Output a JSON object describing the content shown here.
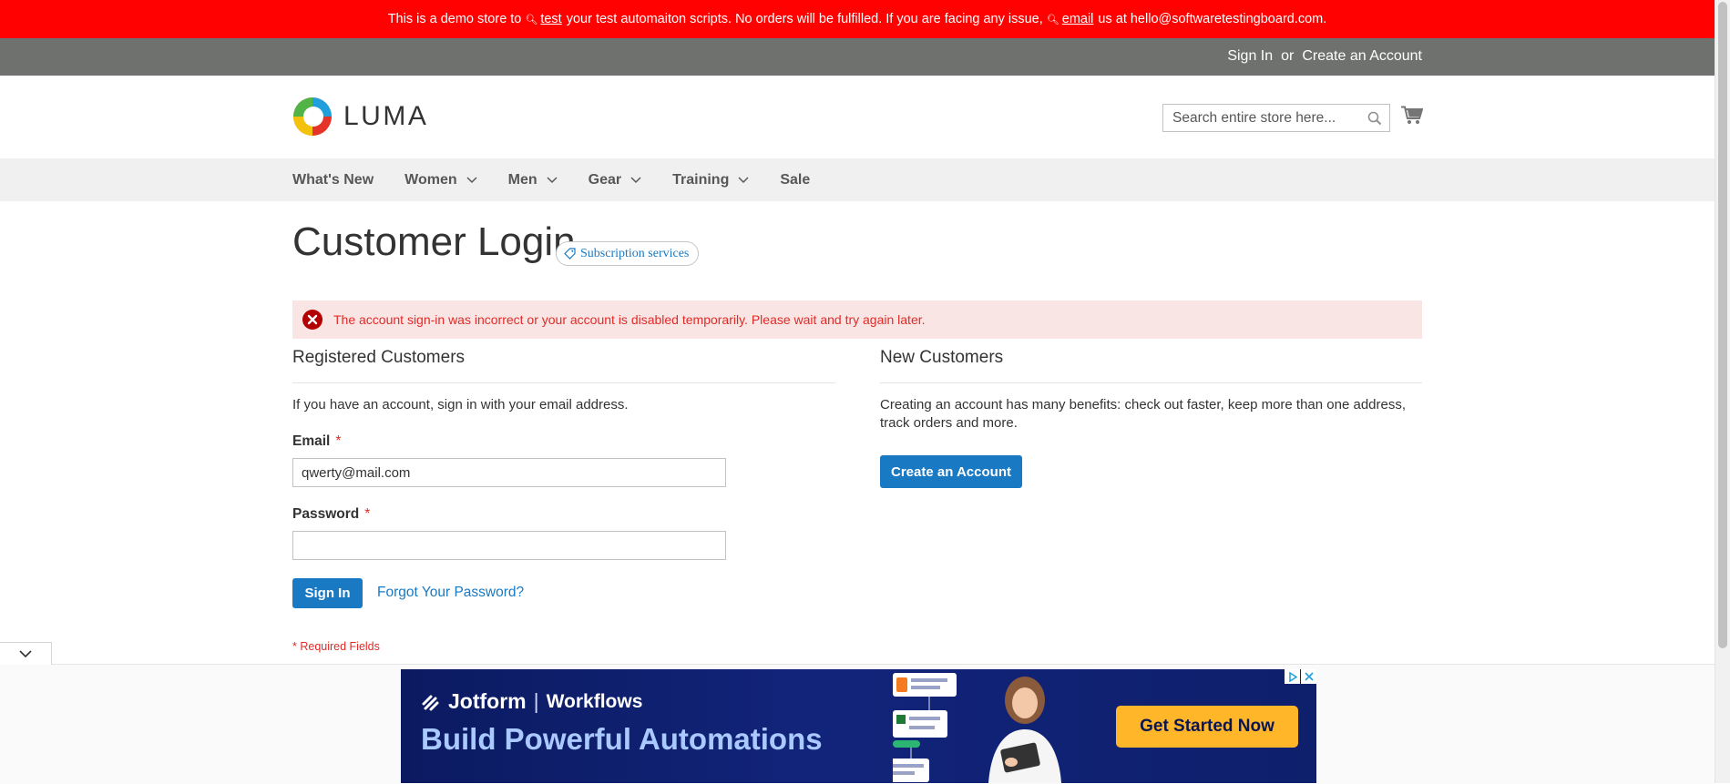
{
  "banner": {
    "text_before": "This is a demo store to",
    "link_test": "test",
    "text_mid": "your test automaiton scripts. No orders will be fulfilled. If you are facing any issue,",
    "link_email": "email",
    "text_after": "us at hello@softwaretestingboard.com.",
    "bg_color": "#ff0101"
  },
  "header": {
    "sign_in": "Sign In",
    "or": "or",
    "create_account": "Create an Account",
    "bg_color": "#6e716e"
  },
  "logo": {
    "text": "LUMA",
    "icon": "luma-logo-icon"
  },
  "search": {
    "placeholder": "Search entire store here...",
    "value": "",
    "icon": "search-icon"
  },
  "cart": {
    "icon": "cart-icon"
  },
  "nav": {
    "items": [
      {
        "label": "What's New",
        "has_dropdown": false
      },
      {
        "label": "Women",
        "has_dropdown": true
      },
      {
        "label": "Men",
        "has_dropdown": true
      },
      {
        "label": "Gear",
        "has_dropdown": true
      },
      {
        "label": "Training",
        "has_dropdown": true
      },
      {
        "label": "Sale",
        "has_dropdown": false
      }
    ]
  },
  "page": {
    "title": "Customer Login",
    "subscription_pill": "Subscription services"
  },
  "error": {
    "message": "The account sign-in was incorrect or your account is disabled temporarily. Please wait and try again later.",
    "color": "#e02b27",
    "bg_color": "#fae5e5"
  },
  "registered": {
    "title": "Registered Customers",
    "intro": "If you have an account, sign in with your email address.",
    "email_label": "Email",
    "email_value": "qwerty@mail.com",
    "password_label": "Password",
    "password_value": "",
    "required_mark": "*",
    "sign_in_button": "Sign In",
    "forgot_link": "Forgot Your Password?",
    "required_note": "* Required Fields"
  },
  "new_customers": {
    "title": "New Customers",
    "intro_line1": "Creating an account has many benefits: check out faster, keep more than one address,",
    "intro_line2": "track orders and more.",
    "create_button": "Create an Account"
  },
  "ad": {
    "brand": "Jotform",
    "separator": "|",
    "product": "Workflows",
    "headline": "Build Powerful Automations",
    "cta": "Get Started Now"
  },
  "accent_color": "#1979c3"
}
